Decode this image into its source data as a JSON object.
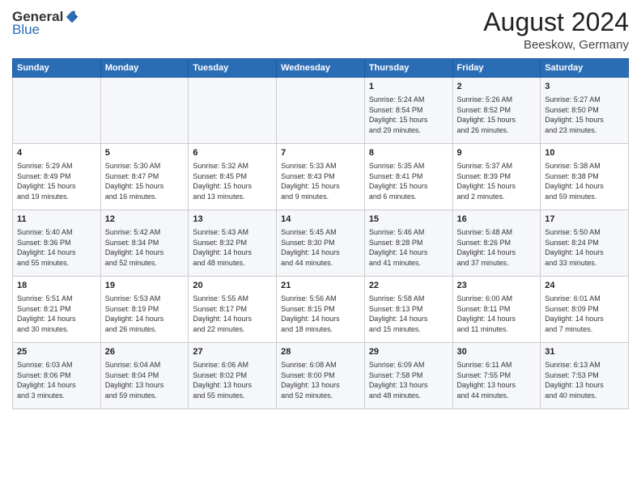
{
  "header": {
    "logo_general": "General",
    "logo_blue": "Blue",
    "month_year": "August 2024",
    "location": "Beeskow, Germany"
  },
  "weekdays": [
    "Sunday",
    "Monday",
    "Tuesday",
    "Wednesday",
    "Thursday",
    "Friday",
    "Saturday"
  ],
  "weeks": [
    [
      {
        "day": "",
        "info": ""
      },
      {
        "day": "",
        "info": ""
      },
      {
        "day": "",
        "info": ""
      },
      {
        "day": "",
        "info": ""
      },
      {
        "day": "1",
        "info": "Sunrise: 5:24 AM\nSunset: 8:54 PM\nDaylight: 15 hours\nand 29 minutes."
      },
      {
        "day": "2",
        "info": "Sunrise: 5:26 AM\nSunset: 8:52 PM\nDaylight: 15 hours\nand 26 minutes."
      },
      {
        "day": "3",
        "info": "Sunrise: 5:27 AM\nSunset: 8:50 PM\nDaylight: 15 hours\nand 23 minutes."
      }
    ],
    [
      {
        "day": "4",
        "info": "Sunrise: 5:29 AM\nSunset: 8:49 PM\nDaylight: 15 hours\nand 19 minutes."
      },
      {
        "day": "5",
        "info": "Sunrise: 5:30 AM\nSunset: 8:47 PM\nDaylight: 15 hours\nand 16 minutes."
      },
      {
        "day": "6",
        "info": "Sunrise: 5:32 AM\nSunset: 8:45 PM\nDaylight: 15 hours\nand 13 minutes."
      },
      {
        "day": "7",
        "info": "Sunrise: 5:33 AM\nSunset: 8:43 PM\nDaylight: 15 hours\nand 9 minutes."
      },
      {
        "day": "8",
        "info": "Sunrise: 5:35 AM\nSunset: 8:41 PM\nDaylight: 15 hours\nand 6 minutes."
      },
      {
        "day": "9",
        "info": "Sunrise: 5:37 AM\nSunset: 8:39 PM\nDaylight: 15 hours\nand 2 minutes."
      },
      {
        "day": "10",
        "info": "Sunrise: 5:38 AM\nSunset: 8:38 PM\nDaylight: 14 hours\nand 59 minutes."
      }
    ],
    [
      {
        "day": "11",
        "info": "Sunrise: 5:40 AM\nSunset: 8:36 PM\nDaylight: 14 hours\nand 55 minutes."
      },
      {
        "day": "12",
        "info": "Sunrise: 5:42 AM\nSunset: 8:34 PM\nDaylight: 14 hours\nand 52 minutes."
      },
      {
        "day": "13",
        "info": "Sunrise: 5:43 AM\nSunset: 8:32 PM\nDaylight: 14 hours\nand 48 minutes."
      },
      {
        "day": "14",
        "info": "Sunrise: 5:45 AM\nSunset: 8:30 PM\nDaylight: 14 hours\nand 44 minutes."
      },
      {
        "day": "15",
        "info": "Sunrise: 5:46 AM\nSunset: 8:28 PM\nDaylight: 14 hours\nand 41 minutes."
      },
      {
        "day": "16",
        "info": "Sunrise: 5:48 AM\nSunset: 8:26 PM\nDaylight: 14 hours\nand 37 minutes."
      },
      {
        "day": "17",
        "info": "Sunrise: 5:50 AM\nSunset: 8:24 PM\nDaylight: 14 hours\nand 33 minutes."
      }
    ],
    [
      {
        "day": "18",
        "info": "Sunrise: 5:51 AM\nSunset: 8:21 PM\nDaylight: 14 hours\nand 30 minutes."
      },
      {
        "day": "19",
        "info": "Sunrise: 5:53 AM\nSunset: 8:19 PM\nDaylight: 14 hours\nand 26 minutes."
      },
      {
        "day": "20",
        "info": "Sunrise: 5:55 AM\nSunset: 8:17 PM\nDaylight: 14 hours\nand 22 minutes."
      },
      {
        "day": "21",
        "info": "Sunrise: 5:56 AM\nSunset: 8:15 PM\nDaylight: 14 hours\nand 18 minutes."
      },
      {
        "day": "22",
        "info": "Sunrise: 5:58 AM\nSunset: 8:13 PM\nDaylight: 14 hours\nand 15 minutes."
      },
      {
        "day": "23",
        "info": "Sunrise: 6:00 AM\nSunset: 8:11 PM\nDaylight: 14 hours\nand 11 minutes."
      },
      {
        "day": "24",
        "info": "Sunrise: 6:01 AM\nSunset: 8:09 PM\nDaylight: 14 hours\nand 7 minutes."
      }
    ],
    [
      {
        "day": "25",
        "info": "Sunrise: 6:03 AM\nSunset: 8:06 PM\nDaylight: 14 hours\nand 3 minutes."
      },
      {
        "day": "26",
        "info": "Sunrise: 6:04 AM\nSunset: 8:04 PM\nDaylight: 13 hours\nand 59 minutes."
      },
      {
        "day": "27",
        "info": "Sunrise: 6:06 AM\nSunset: 8:02 PM\nDaylight: 13 hours\nand 55 minutes."
      },
      {
        "day": "28",
        "info": "Sunrise: 6:08 AM\nSunset: 8:00 PM\nDaylight: 13 hours\nand 52 minutes."
      },
      {
        "day": "29",
        "info": "Sunrise: 6:09 AM\nSunset: 7:58 PM\nDaylight: 13 hours\nand 48 minutes."
      },
      {
        "day": "30",
        "info": "Sunrise: 6:11 AM\nSunset: 7:55 PM\nDaylight: 13 hours\nand 44 minutes."
      },
      {
        "day": "31",
        "info": "Sunrise: 6:13 AM\nSunset: 7:53 PM\nDaylight: 13 hours\nand 40 minutes."
      }
    ]
  ]
}
